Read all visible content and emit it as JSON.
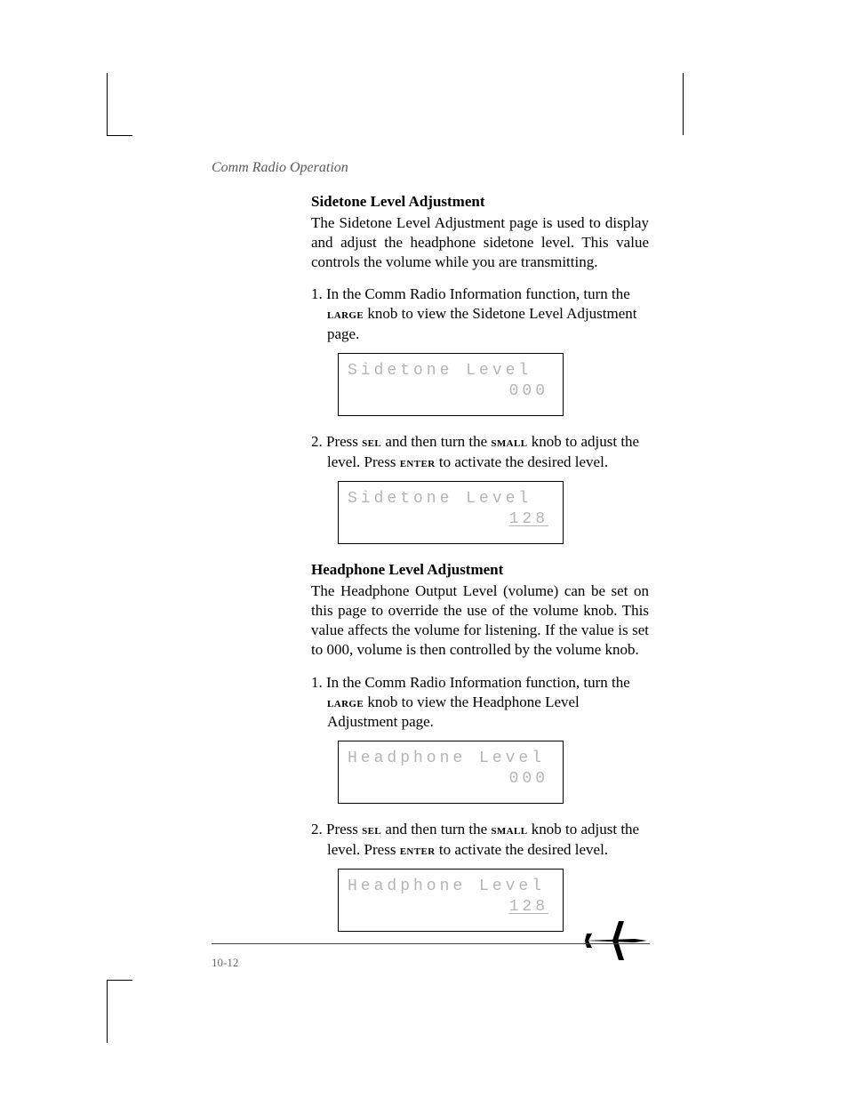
{
  "header": "Comm Radio Operation",
  "page_number": "10-12",
  "section1": {
    "heading": "Sidetone Level Adjustment",
    "para": "The Sidetone Level Adjustment page is used to display and adjust the headphone sidetone level. This value controls the volume while you are transmitting.",
    "step1_prefix": "1. In the Comm Radio Information function, turn the ",
    "step1_knob": "large",
    "step1_suffix": " knob to view the Sidetone Level Adjustment page.",
    "lcd1_line1": "Sidetone Level",
    "lcd1_line2": "000",
    "step2_prefix": "2. Press ",
    "step2_sel": "sel",
    "step2_mid1": " and then turn the ",
    "step2_small": "small",
    "step2_mid2": " knob to adjust the level. Press ",
    "step2_enter": "enter",
    "step2_suffix": " to activate the desired level.",
    "lcd2_line1": "Sidetone Level",
    "lcd2_line2": "128"
  },
  "section2": {
    "heading": "Headphone Level Adjustment",
    "para": "The Headphone Output Level (volume) can be set on this page to override the use of the volume knob. This value affects the volume for listening. If the value is set to 000, volume is then controlled by the volume knob.",
    "step1_prefix": "1. In the Comm Radio Information function, turn the ",
    "step1_knob": "large",
    "step1_suffix": " knob to view the Headphone Level Adjustment page.",
    "lcd1_line1": "Headphone Level",
    "lcd1_line2": "000",
    "step2_prefix": "2. Press ",
    "step2_sel": "sel",
    "step2_mid1": " and then turn the ",
    "step2_small": "small",
    "step2_mid2": " knob to adjust the level. Press ",
    "step2_enter": "enter",
    "step2_suffix": " to activate the desired level.",
    "lcd2_line1": "Headphone Level",
    "lcd2_line2": "128"
  }
}
